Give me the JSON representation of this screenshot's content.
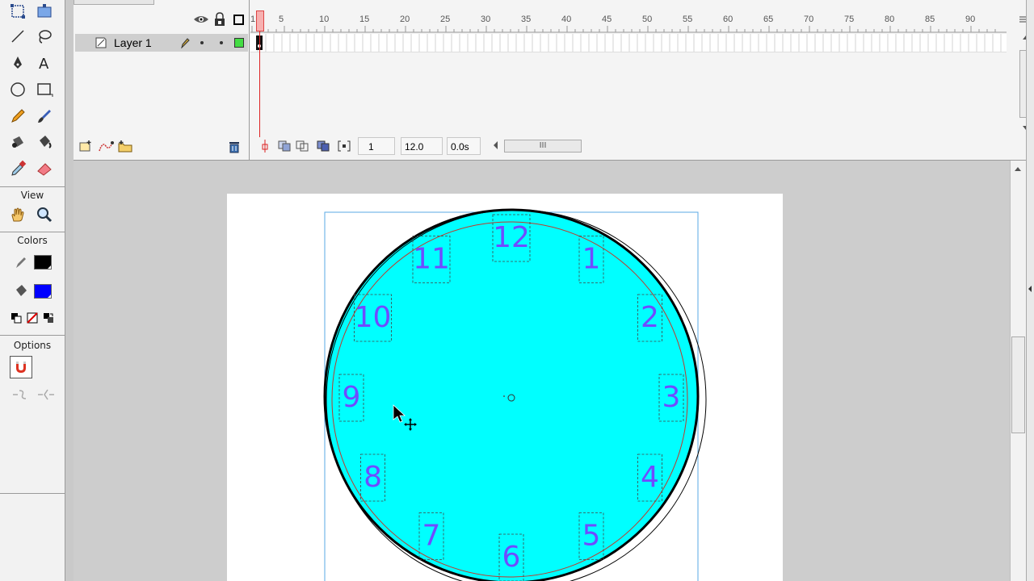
{
  "toolbox": {
    "view_label": "View",
    "colors_label": "Colors",
    "options_label": "Options",
    "stroke_color": "#000000",
    "fill_color": "#0000ff"
  },
  "timeline": {
    "layer_name": "Layer 1",
    "ruler_ticks": [
      "1",
      "5",
      "10",
      "15",
      "20",
      "25",
      "30",
      "35",
      "40",
      "45",
      "50",
      "55",
      "60",
      "65",
      "70",
      "75",
      "80",
      "85",
      "90"
    ],
    "current_frame": "1",
    "frame_rate": "12.0 fps",
    "elapsed_time": "0.0s",
    "scrollbar_grip": "III",
    "layer_color": "#44dd44"
  },
  "stage": {
    "clock_fill": "#00ffff",
    "number_color": "#6f4bff",
    "clock_numbers": [
      "12",
      "1",
      "2",
      "3",
      "4",
      "5",
      "6",
      "7",
      "8",
      "9",
      "10",
      "11"
    ]
  }
}
